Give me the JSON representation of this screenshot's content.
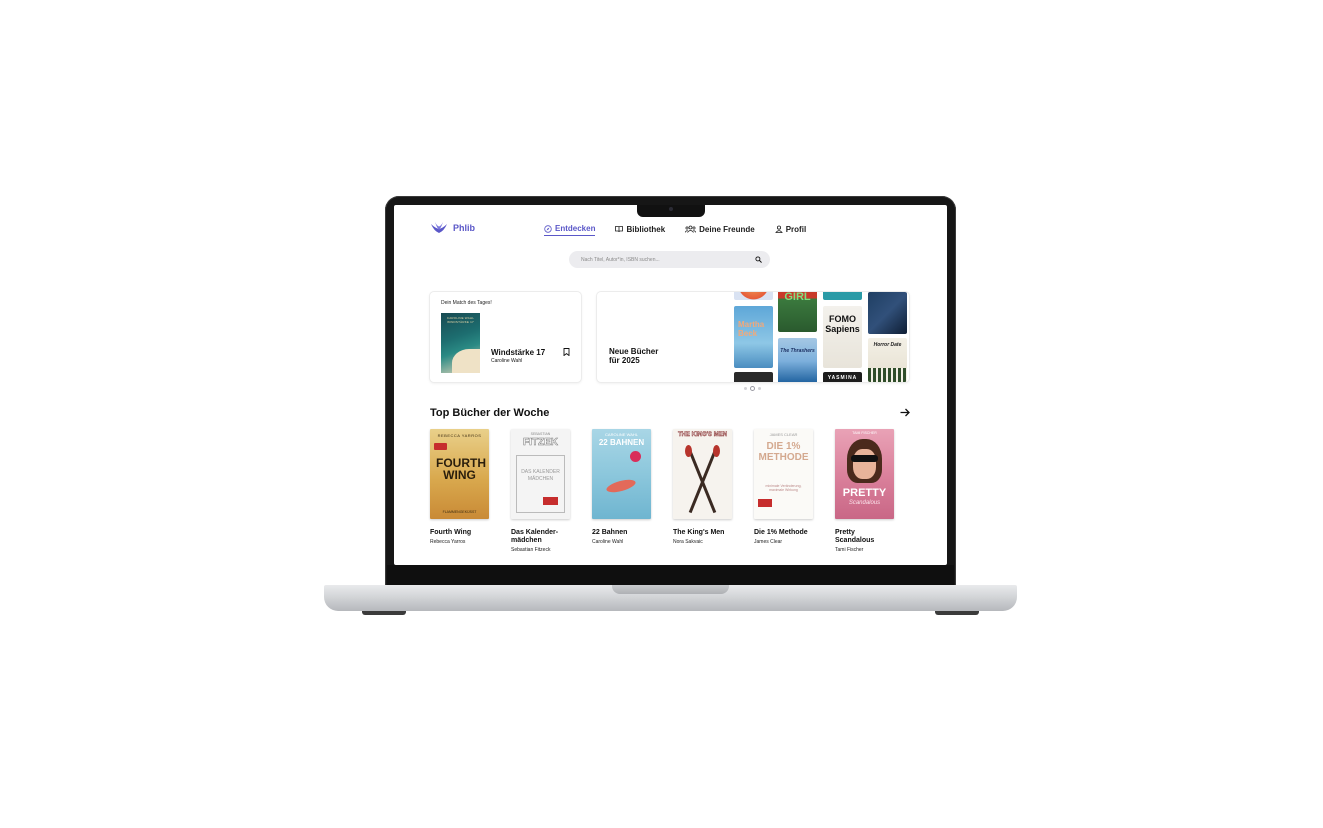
{
  "app": {
    "name": "Phlib",
    "brand_color": "#5a57c8"
  },
  "nav": [
    {
      "label": "Entdecken",
      "icon": "compass-icon",
      "active": true
    },
    {
      "label": "Bibliothek",
      "icon": "book-icon",
      "active": false
    },
    {
      "label": "Deine Freunde",
      "icon": "friends-icon",
      "active": false
    },
    {
      "label": "Profil",
      "icon": "user-icon",
      "active": false
    }
  ],
  "search": {
    "placeholder": "Nach Titel, Autor*in, ISBN suchen..."
  },
  "match": {
    "heading": "Dein Match des Tages!",
    "book_title": "Windstärke 17",
    "book_author": "Caroline Wahl",
    "cover_text": "CAROLINE WAHL WINDSTÄRKE 17"
  },
  "new_books": {
    "title_line1": "Neue Bücher",
    "title_line2": "für 2025",
    "cover_texts": [
      "Martha Beck",
      "GIRL",
      "FOMO Sapiens",
      "The Thrashers",
      "Horror Date",
      "YASMINA"
    ]
  },
  "carousel": {
    "pages": 3,
    "active": 2
  },
  "top_books": {
    "heading": "Top Bücher der Woche",
    "books": [
      {
        "title": "Fourth Wing",
        "author": "Rebecca Yarros",
        "cover_top": "REBECCA YARROS",
        "cover_main": "FOURTH WING",
        "cover_sub": "FLAMMENGEKÜSST"
      },
      {
        "title": "Das Kalender-mädchen",
        "author": "Sebastian Fitzeck",
        "cover_top": "SEBASTIAN",
        "cover_main": "FITZEK",
        "cover_sub": "DAS KALENDER MÄDCHEN"
      },
      {
        "title": "22 Bahnen",
        "author": "Caroline Wahl",
        "cover_top": "CAROLINE WAHL",
        "cover_main": "22 BAHNEN",
        "cover_sub": ""
      },
      {
        "title": "The King's Men",
        "author": "Nora Sakvaic",
        "cover_top": "",
        "cover_main": "THE KING'S MEN",
        "cover_sub": ""
      },
      {
        "title": "Die 1% Methode",
        "author": "James Clear",
        "cover_top": "JAMES CLEAR",
        "cover_main": "DIE 1% METHODE",
        "cover_sub": "minimale Veränderung, maximale Wirkung"
      },
      {
        "title": "Pretty Scandalous",
        "author": "Tami Fischer",
        "cover_top": "TAMI FISCHER",
        "cover_main": "PRETTY",
        "cover_sub": "Scandalous"
      }
    ]
  }
}
